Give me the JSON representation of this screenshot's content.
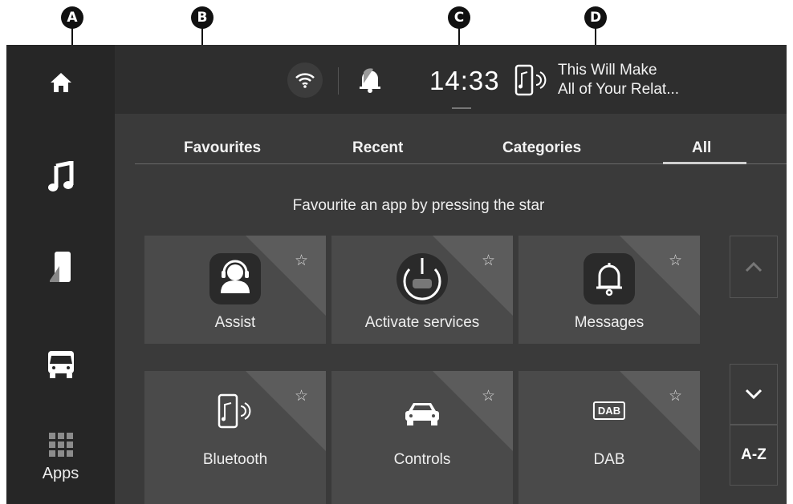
{
  "callouts": [
    "A",
    "B",
    "C",
    "D"
  ],
  "sidebar": {
    "items": [
      {
        "name": "home",
        "icon": "home-icon"
      },
      {
        "name": "music",
        "icon": "music-note-icon"
      },
      {
        "name": "phone",
        "icon": "phone-icon"
      },
      {
        "name": "vehicle",
        "icon": "van-icon"
      },
      {
        "name": "apps",
        "icon": "grid-icon",
        "label": "Apps"
      }
    ]
  },
  "header": {
    "clock": "14:33",
    "now_playing_line1": "This Will Make",
    "now_playing_line2": "All of Your Relat...",
    "status_icons": [
      "wifi-icon",
      "notification-bell-icon",
      "bluetooth-phone-audio-icon"
    ]
  },
  "tabs": [
    {
      "label": "Favourites"
    },
    {
      "label": "Recent"
    },
    {
      "label": "Categories"
    },
    {
      "label": "All",
      "selected": true
    }
  ],
  "hint": "Favourite an app by pressing the star",
  "apps": [
    {
      "label": "Assist",
      "icon": "assist-headset-icon"
    },
    {
      "label": "Activate services",
      "icon": "power-car-icon"
    },
    {
      "label": "Messages",
      "icon": "bell-icon"
    },
    {
      "label": "Bluetooth",
      "icon": "bluetooth-phone-audio-icon"
    },
    {
      "label": "Controls",
      "icon": "car-icon"
    },
    {
      "label": "DAB",
      "icon": "dab-icon",
      "badge": "DAB"
    }
  ],
  "nav": {
    "az_label": "A-Z"
  },
  "colors": {
    "screen_bg": "#3b3b3b",
    "sidebar_bg": "#262626",
    "tile_bg": "#4a4a4a",
    "accent": "#ffffff"
  }
}
